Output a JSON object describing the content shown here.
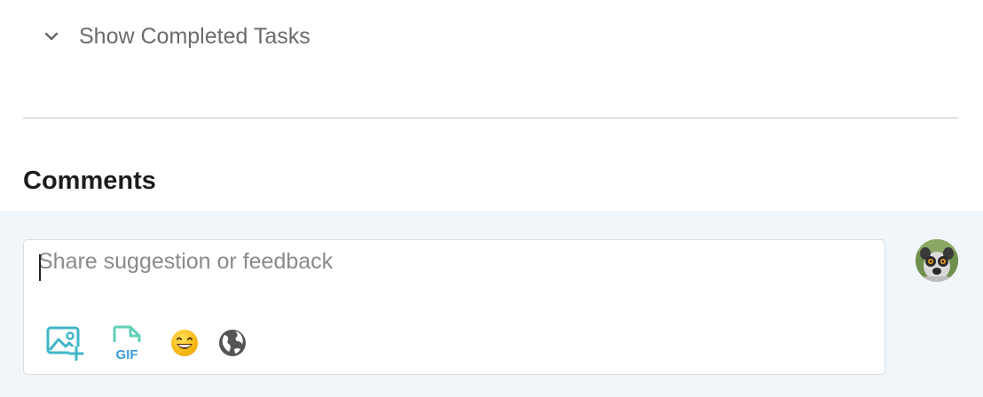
{
  "tasks": {
    "show_completed_label": "Show Completed Tasks"
  },
  "comments": {
    "heading": "Comments",
    "input_placeholder": "Share suggestion or feedback",
    "input_value": "",
    "toolbar": [
      {
        "icon": "image-add-icon",
        "color": "#3fb6c8"
      },
      {
        "icon": "gif-icon",
        "color": "#3fb6c8"
      },
      {
        "icon": "emoji-icon",
        "color": "#f6b400"
      },
      {
        "icon": "globe-icon",
        "color": "#555555"
      }
    ]
  },
  "colors": {
    "composer_bg": "#f1f6fa",
    "divider": "#e1e1e1",
    "muted_text": "#6b6b6b",
    "heading_text": "#1c1c1c"
  },
  "user": {
    "avatar": "lemur-avatar-icon"
  }
}
